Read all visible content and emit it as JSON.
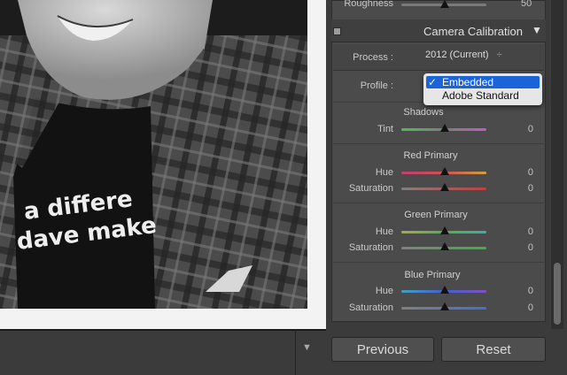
{
  "top_row": {
    "label": "Roughness",
    "value": "50"
  },
  "camera_calibration": {
    "title": "Camera Calibration",
    "process": {
      "label": "Process :",
      "value": "2012 (Current)",
      "arrow": "÷"
    },
    "profile": {
      "label": "Profile :",
      "options": [
        "Embedded",
        "Adobe Standard"
      ],
      "selected_mark": "✓"
    },
    "shadows": {
      "title": "Shadows",
      "tint_label": "Tint",
      "tint_value": "0"
    },
    "red": {
      "title": "Red Primary",
      "hue_label": "Hue",
      "hue_value": "0",
      "sat_label": "Saturation",
      "sat_value": "0"
    },
    "green": {
      "title": "Green Primary",
      "hue_label": "Hue",
      "hue_value": "0",
      "sat_label": "Saturation",
      "sat_value": "0"
    },
    "blue": {
      "title": "Blue Primary",
      "hue_label": "Hue",
      "hue_value": "0",
      "sat_label": "Saturation",
      "sat_value": "0"
    }
  },
  "buttons": {
    "previous": "Previous",
    "reset": "Reset"
  },
  "photo": {
    "shirt_text_1": "a differe",
    "shirt_text_2": "dave make"
  },
  "icons": {
    "collapse": "▼",
    "filmstrip_toggle": "▼"
  }
}
